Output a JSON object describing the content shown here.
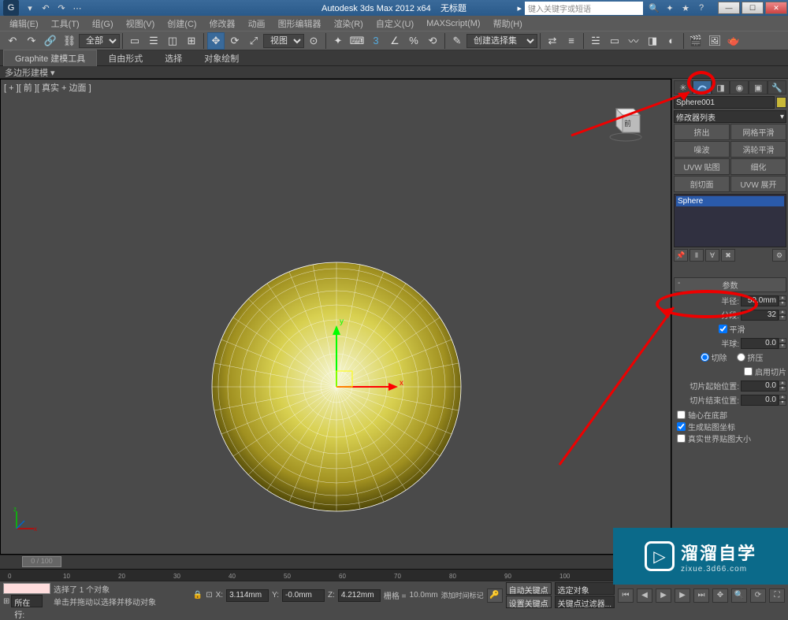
{
  "title": {
    "app": "Autodesk 3ds Max  2012  x64",
    "doc": "无标题"
  },
  "search_placeholder": "键入关键字或短语",
  "menubar": [
    "编辑(E)",
    "工具(T)",
    "组(G)",
    "视图(V)",
    "创建(C)",
    "修改器",
    "动画",
    "图形编辑器",
    "渲染(R)",
    "自定义(U)",
    "MAXScript(M)",
    "帮助(H)"
  ],
  "toolbar_dropdowns": {
    "all": "全部",
    "view": "视图",
    "selset": "创建选择集"
  },
  "ribbon": {
    "main": "Graphite 建模工具",
    "tabs": [
      "自由形式",
      "选择",
      "对象绘制"
    ],
    "sub": "多边形建模"
  },
  "viewport_label": "[ + ][ 前 ][ 真实 + 边面 ]",
  "panel": {
    "object_name": "Sphere001",
    "modifier_list": "修改器列表",
    "mod_buttons": [
      [
        "挤出",
        "网格平滑"
      ],
      [
        "噪波",
        "涡轮平滑"
      ],
      [
        "UVW 贴图",
        "细化"
      ],
      [
        "剖切面",
        "UVW 展开"
      ]
    ],
    "stack_item": "Sphere",
    "rollout": "参数",
    "radius_label": "半径:",
    "radius_value": "50.0mm",
    "segments_label": "分段:",
    "segments_value": "32",
    "smooth": "平滑",
    "hemi_label": "半球:",
    "hemi_value": "0.0",
    "chop": "切除",
    "squash": "挤压",
    "slice_on": "启用切片",
    "slice_from_label": "切片起始位置:",
    "slice_from_value": "0.0",
    "slice_to_label": "切片结束位置:",
    "slice_to_value": "0.0",
    "base_pivot": "轴心在底部",
    "gen_map": "生成贴图坐标",
    "realworld": "真实世界贴图大小"
  },
  "timeline": {
    "frame": "0 / 100"
  },
  "status": {
    "sel": "选择了 1 个对象",
    "prompt": "单击并拖动以选择并移动对象",
    "x_label": "X:",
    "x": "3.114mm",
    "y_label": "Y:",
    "y": "-0.0mm",
    "z_label": "Z:",
    "z": "4.212mm",
    "grid_label": "栅格 =",
    "grid": "10.0mm",
    "autokey": "自动关键点",
    "selkey": "选定对象",
    "addtime": "添加时间标记",
    "setkey": "设置关键点",
    "keyfilter": "关键点过滤器...",
    "location_label": "所在行:"
  },
  "watermark": {
    "brand": "溜溜自学",
    "url": "zixue.3d66.com"
  },
  "chart_data": {
    "type": "3d-primitive",
    "object": "Sphere",
    "radius_mm": 50.0,
    "segments": 32,
    "hemisphere": 0.0,
    "slice_from": 0.0,
    "slice_to": 0.0,
    "smooth": true,
    "position_mm": {
      "x": 3.114,
      "y": -0.0,
      "z": 4.212
    }
  }
}
